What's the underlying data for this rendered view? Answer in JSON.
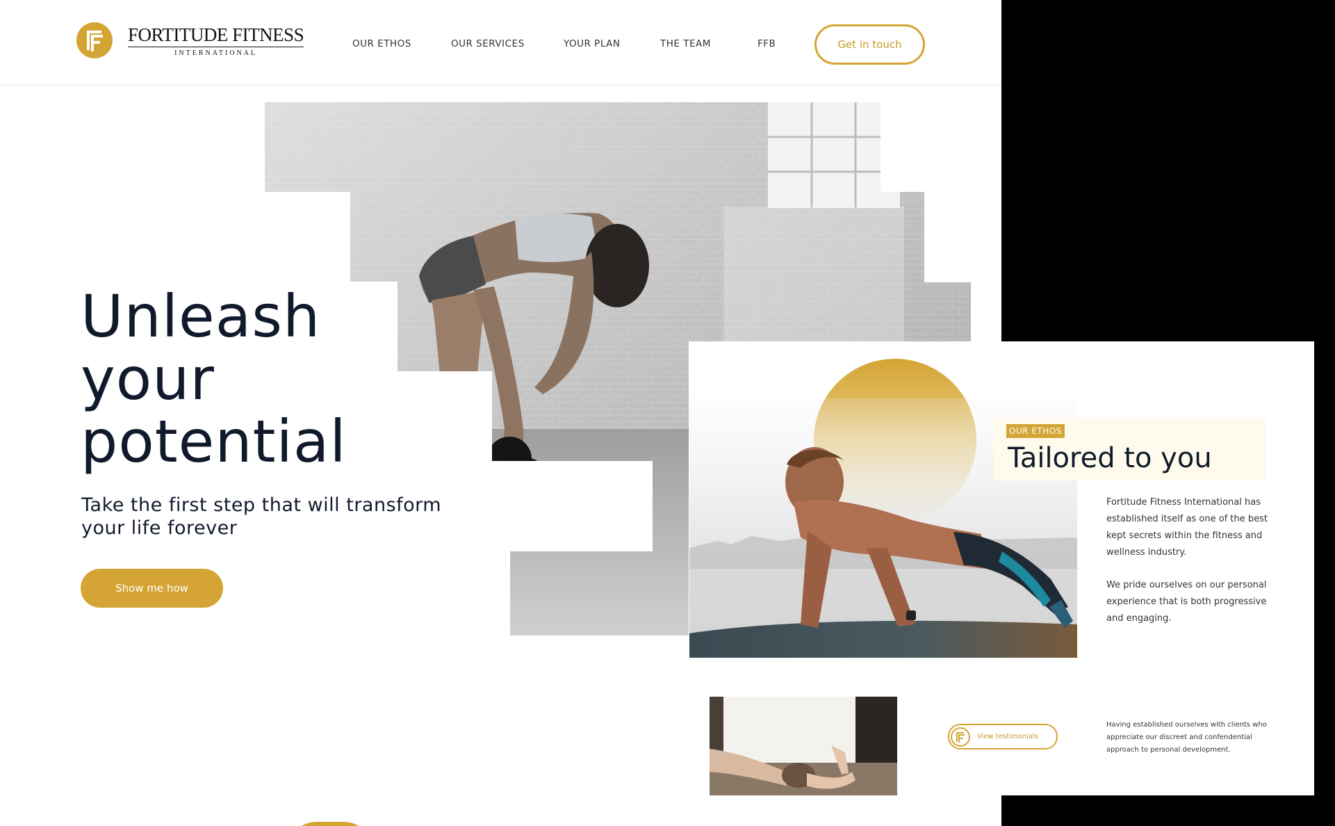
{
  "brand": {
    "name": "FORTITUDE FITNESS",
    "tagline": "INTERNATIONAL",
    "accent_color": "#d4a534",
    "text_color": "#111a2c"
  },
  "nav": {
    "items": [
      {
        "label": "OUR ETHOS"
      },
      {
        "label": "OUR SERVICES"
      },
      {
        "label": "YOUR PLAN"
      },
      {
        "label": "THE TEAM"
      },
      {
        "label": "FFB"
      }
    ],
    "cta_label": "Get in touch"
  },
  "hero": {
    "title_lines": [
      "Unleash",
      "your",
      "potential"
    ],
    "subtitle": "Take the first step that will transform your life forever",
    "cta_label": "Show me how",
    "image_icon": "kettlebell-athlete-photo"
  },
  "ethos": {
    "eyebrow": "OUR ETHOS",
    "title": "Tailored to you",
    "paragraphs": [
      "Fortitude Fitness International has established itself as one of the best kept secrets within the fitness and wellness industry.",
      "We pride ourselves on our personal experience that is both progressive and engaging."
    ],
    "testimonials_label": "View testimonials",
    "note": "Having established ourselves with clients who appreciate our discreet and confendential approach to personal development.",
    "image_icons": [
      "pushup-athlete-photo",
      "stretching-athlete-photo"
    ]
  }
}
